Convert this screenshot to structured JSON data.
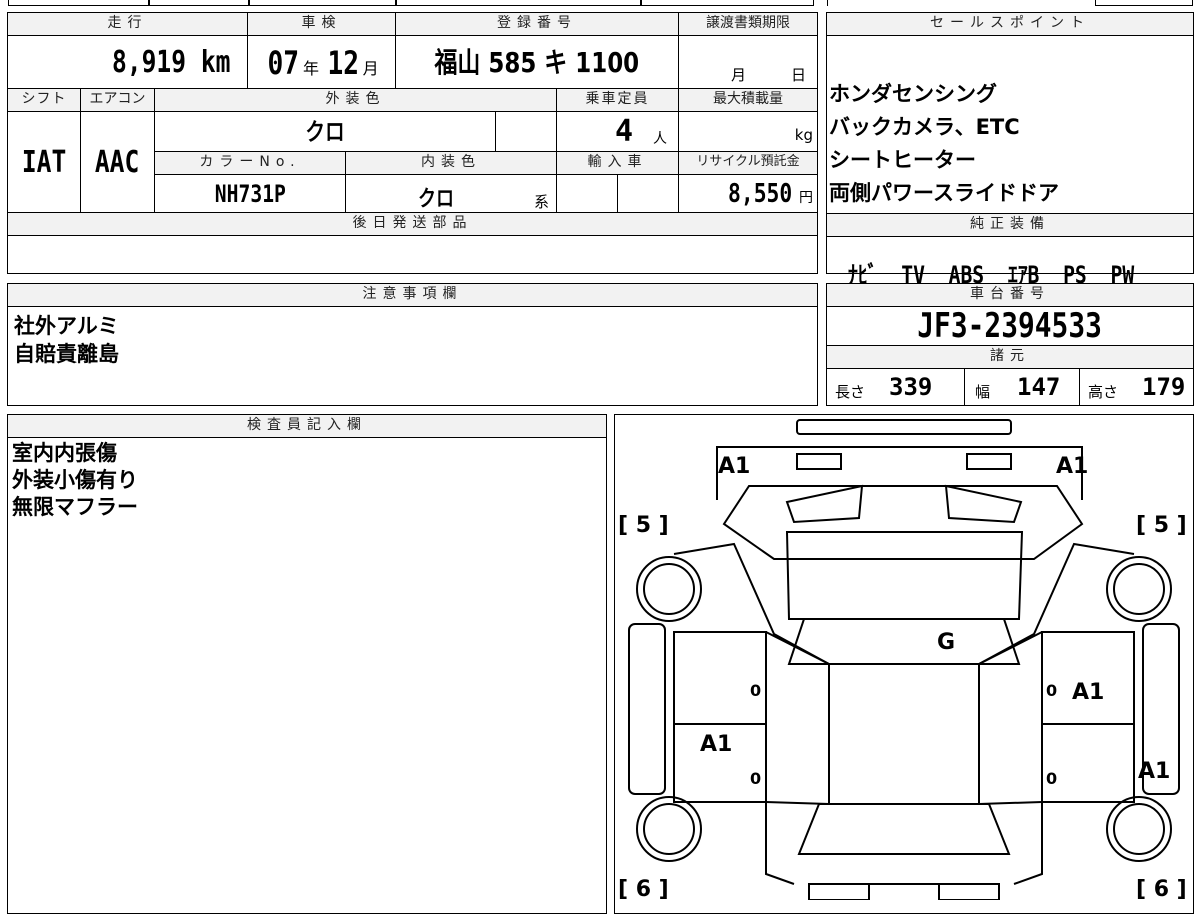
{
  "headers": {
    "mileage": "走行",
    "inspection": "車検",
    "registration": "登録番号",
    "transfer_deadline": "譲渡書類期限",
    "shift": "シフト",
    "aircon": "エアコン",
    "exterior_color": "外装色",
    "capacity": "乗車定員",
    "max_load": "最大積載量",
    "color_no": "カラーNo.",
    "interior_color": "内装色",
    "import": "輸入車",
    "recycle": "リサイクル預託金",
    "later_parts": "後日発送部品",
    "sales_points": "セールスポイント",
    "standard_equipment": "純正装備",
    "notes": "注意事項欄",
    "chassis": "車台番号",
    "specs": "諸元",
    "inspector": "検査員記入欄"
  },
  "values": {
    "mileage": "8,919",
    "mileage_unit": "km",
    "inspection_year": "07",
    "year_unit": "年",
    "inspection_month": "12",
    "month_unit": "月",
    "plate": "福山 585 キ 1100",
    "deadline_month": "月",
    "deadline_day": "日",
    "shift": "IAT",
    "aircon": "AAC",
    "exterior_color": "クロ",
    "capacity": "4",
    "capacity_unit": "人",
    "load_unit": "kg",
    "color_no": "NH731P",
    "interior_color": "クロ",
    "interior_suffix": "系",
    "recycle": "8,550",
    "recycle_unit": "円"
  },
  "sales_points": [
    "ホンダセンシング",
    "バックカメラ、ETC",
    "シートヒーター",
    "両側パワースライドドア"
  ],
  "equipment": "ﾅﾋﾞ  TV  ABS  ｴｱB  PS  PW",
  "notes": "社外アルミ\n自賠責離島",
  "chassis_number": "JF3-2394533",
  "specs": {
    "length_label": "長さ",
    "length": "339",
    "width_label": "幅",
    "width": "147",
    "height_label": "高さ",
    "height": "179"
  },
  "inspector_notes": "室内内張傷\n外装小傷有り\n無限マフラー",
  "diagram": {
    "a1_front_left": "A1",
    "a1_front_right": "A1",
    "bracket_5_left": "[ 5 ]",
    "bracket_5_right": "[ 5 ]",
    "bracket_6_left": "[ 6 ]",
    "bracket_6_right": "[ 6 ]",
    "g_windshield": "G",
    "a1_right_door": "A1",
    "a1_left_rear": "A1",
    "a1_right_rear": "A1",
    "zero_1": "0",
    "zero_2": "0",
    "zero_3": "0",
    "zero_4": "0"
  }
}
